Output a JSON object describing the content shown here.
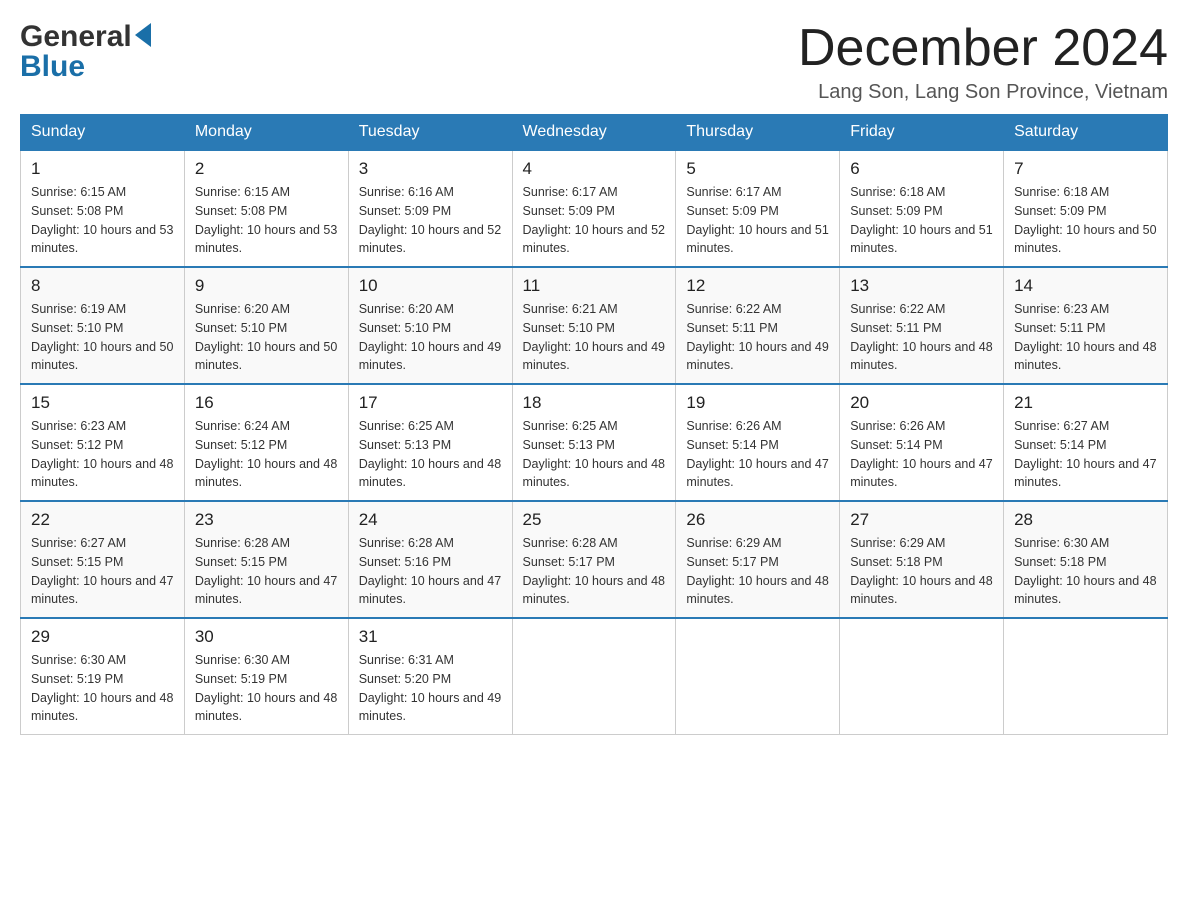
{
  "header": {
    "logo": {
      "general": "General",
      "blue": "Blue"
    },
    "title": "December 2024",
    "location": "Lang Son, Lang Son Province, Vietnam"
  },
  "calendar": {
    "days_of_week": [
      "Sunday",
      "Monday",
      "Tuesday",
      "Wednesday",
      "Thursday",
      "Friday",
      "Saturday"
    ],
    "weeks": [
      [
        {
          "day": "1",
          "sunrise": "Sunrise: 6:15 AM",
          "sunset": "Sunset: 5:08 PM",
          "daylight": "Daylight: 10 hours and 53 minutes."
        },
        {
          "day": "2",
          "sunrise": "Sunrise: 6:15 AM",
          "sunset": "Sunset: 5:08 PM",
          "daylight": "Daylight: 10 hours and 53 minutes."
        },
        {
          "day": "3",
          "sunrise": "Sunrise: 6:16 AM",
          "sunset": "Sunset: 5:09 PM",
          "daylight": "Daylight: 10 hours and 52 minutes."
        },
        {
          "day": "4",
          "sunrise": "Sunrise: 6:17 AM",
          "sunset": "Sunset: 5:09 PM",
          "daylight": "Daylight: 10 hours and 52 minutes."
        },
        {
          "day": "5",
          "sunrise": "Sunrise: 6:17 AM",
          "sunset": "Sunset: 5:09 PM",
          "daylight": "Daylight: 10 hours and 51 minutes."
        },
        {
          "day": "6",
          "sunrise": "Sunrise: 6:18 AM",
          "sunset": "Sunset: 5:09 PM",
          "daylight": "Daylight: 10 hours and 51 minutes."
        },
        {
          "day": "7",
          "sunrise": "Sunrise: 6:18 AM",
          "sunset": "Sunset: 5:09 PM",
          "daylight": "Daylight: 10 hours and 50 minutes."
        }
      ],
      [
        {
          "day": "8",
          "sunrise": "Sunrise: 6:19 AM",
          "sunset": "Sunset: 5:10 PM",
          "daylight": "Daylight: 10 hours and 50 minutes."
        },
        {
          "day": "9",
          "sunrise": "Sunrise: 6:20 AM",
          "sunset": "Sunset: 5:10 PM",
          "daylight": "Daylight: 10 hours and 50 minutes."
        },
        {
          "day": "10",
          "sunrise": "Sunrise: 6:20 AM",
          "sunset": "Sunset: 5:10 PM",
          "daylight": "Daylight: 10 hours and 49 minutes."
        },
        {
          "day": "11",
          "sunrise": "Sunrise: 6:21 AM",
          "sunset": "Sunset: 5:10 PM",
          "daylight": "Daylight: 10 hours and 49 minutes."
        },
        {
          "day": "12",
          "sunrise": "Sunrise: 6:22 AM",
          "sunset": "Sunset: 5:11 PM",
          "daylight": "Daylight: 10 hours and 49 minutes."
        },
        {
          "day": "13",
          "sunrise": "Sunrise: 6:22 AM",
          "sunset": "Sunset: 5:11 PM",
          "daylight": "Daylight: 10 hours and 48 minutes."
        },
        {
          "day": "14",
          "sunrise": "Sunrise: 6:23 AM",
          "sunset": "Sunset: 5:11 PM",
          "daylight": "Daylight: 10 hours and 48 minutes."
        }
      ],
      [
        {
          "day": "15",
          "sunrise": "Sunrise: 6:23 AM",
          "sunset": "Sunset: 5:12 PM",
          "daylight": "Daylight: 10 hours and 48 minutes."
        },
        {
          "day": "16",
          "sunrise": "Sunrise: 6:24 AM",
          "sunset": "Sunset: 5:12 PM",
          "daylight": "Daylight: 10 hours and 48 minutes."
        },
        {
          "day": "17",
          "sunrise": "Sunrise: 6:25 AM",
          "sunset": "Sunset: 5:13 PM",
          "daylight": "Daylight: 10 hours and 48 minutes."
        },
        {
          "day": "18",
          "sunrise": "Sunrise: 6:25 AM",
          "sunset": "Sunset: 5:13 PM",
          "daylight": "Daylight: 10 hours and 48 minutes."
        },
        {
          "day": "19",
          "sunrise": "Sunrise: 6:26 AM",
          "sunset": "Sunset: 5:14 PM",
          "daylight": "Daylight: 10 hours and 47 minutes."
        },
        {
          "day": "20",
          "sunrise": "Sunrise: 6:26 AM",
          "sunset": "Sunset: 5:14 PM",
          "daylight": "Daylight: 10 hours and 47 minutes."
        },
        {
          "day": "21",
          "sunrise": "Sunrise: 6:27 AM",
          "sunset": "Sunset: 5:14 PM",
          "daylight": "Daylight: 10 hours and 47 minutes."
        }
      ],
      [
        {
          "day": "22",
          "sunrise": "Sunrise: 6:27 AM",
          "sunset": "Sunset: 5:15 PM",
          "daylight": "Daylight: 10 hours and 47 minutes."
        },
        {
          "day": "23",
          "sunrise": "Sunrise: 6:28 AM",
          "sunset": "Sunset: 5:15 PM",
          "daylight": "Daylight: 10 hours and 47 minutes."
        },
        {
          "day": "24",
          "sunrise": "Sunrise: 6:28 AM",
          "sunset": "Sunset: 5:16 PM",
          "daylight": "Daylight: 10 hours and 47 minutes."
        },
        {
          "day": "25",
          "sunrise": "Sunrise: 6:28 AM",
          "sunset": "Sunset: 5:17 PM",
          "daylight": "Daylight: 10 hours and 48 minutes."
        },
        {
          "day": "26",
          "sunrise": "Sunrise: 6:29 AM",
          "sunset": "Sunset: 5:17 PM",
          "daylight": "Daylight: 10 hours and 48 minutes."
        },
        {
          "day": "27",
          "sunrise": "Sunrise: 6:29 AM",
          "sunset": "Sunset: 5:18 PM",
          "daylight": "Daylight: 10 hours and 48 minutes."
        },
        {
          "day": "28",
          "sunrise": "Sunrise: 6:30 AM",
          "sunset": "Sunset: 5:18 PM",
          "daylight": "Daylight: 10 hours and 48 minutes."
        }
      ],
      [
        {
          "day": "29",
          "sunrise": "Sunrise: 6:30 AM",
          "sunset": "Sunset: 5:19 PM",
          "daylight": "Daylight: 10 hours and 48 minutes."
        },
        {
          "day": "30",
          "sunrise": "Sunrise: 6:30 AM",
          "sunset": "Sunset: 5:19 PM",
          "daylight": "Daylight: 10 hours and 48 minutes."
        },
        {
          "day": "31",
          "sunrise": "Sunrise: 6:31 AM",
          "sunset": "Sunset: 5:20 PM",
          "daylight": "Daylight: 10 hours and 49 minutes."
        },
        {
          "day": "",
          "sunrise": "",
          "sunset": "",
          "daylight": ""
        },
        {
          "day": "",
          "sunrise": "",
          "sunset": "",
          "daylight": ""
        },
        {
          "day": "",
          "sunrise": "",
          "sunset": "",
          "daylight": ""
        },
        {
          "day": "",
          "sunrise": "",
          "sunset": "",
          "daylight": ""
        }
      ]
    ]
  }
}
